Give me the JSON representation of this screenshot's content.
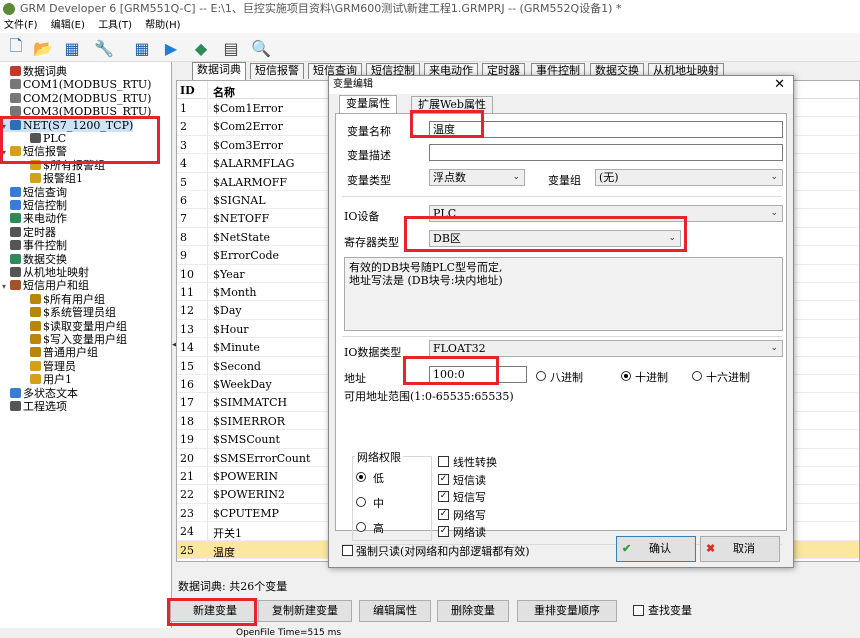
{
  "window": {
    "title": "GRM Developer 6 [GRM551Q-C]  -- E:\\1、巨控实施项目资料\\GRM600测试\\新建工程1.GRMPRJ -- (GRM552Q设备1) *"
  },
  "menu": [
    "文件(F)",
    "编辑(E)",
    "工具(T)",
    "帮助(H)"
  ],
  "toolbar": [
    {
      "icon": "new-file-icon",
      "glyph": "🗋"
    },
    {
      "icon": "open-folder-icon",
      "glyph": "📂"
    },
    {
      "icon": "save-icon",
      "glyph": "▦"
    },
    {
      "icon": "wrench-icon",
      "glyph": "🔧"
    },
    {
      "icon": "grid-icon",
      "glyph": "▦"
    },
    {
      "icon": "download-icon",
      "glyph": "▶"
    },
    {
      "icon": "upload-icon",
      "glyph": "◆"
    },
    {
      "icon": "monitor-icon",
      "glyph": "▤"
    },
    {
      "icon": "search-icon",
      "glyph": "🔍"
    }
  ],
  "tree": [
    {
      "label": "数据词典",
      "icon": "dictionary-icon",
      "color": "#c0392b",
      "depth": 0
    },
    {
      "label": "COM1(MODBUS_RTU)",
      "icon": "serial-port-icon",
      "color": "#777777",
      "depth": 0
    },
    {
      "label": "COM2(MODBUS_RTU)",
      "icon": "serial-port-icon",
      "color": "#777777",
      "depth": 0
    },
    {
      "label": "COM3(MODBUS_RTU)",
      "icon": "serial-port-icon",
      "color": "#777777",
      "depth": 0
    },
    {
      "label": "NET(S7_1200_TCP)",
      "icon": "network-icon",
      "color": "#2c6fb8",
      "depth": 0,
      "expander": "▾",
      "selected": true
    },
    {
      "label": "PLC",
      "icon": "plc-icon",
      "color": "#555555",
      "depth": 1
    },
    {
      "label": "短信报警",
      "icon": "bell-icon",
      "color": "#d4a017",
      "depth": 0,
      "expander": "▾"
    },
    {
      "label": "$所有报警组",
      "icon": "alarm-group-icon",
      "color": "#d4a017",
      "depth": 1
    },
    {
      "label": "报警组1",
      "icon": "alarm-group-icon",
      "color": "#d4a017",
      "depth": 1
    },
    {
      "label": "短信查询",
      "icon": "sms-query-icon",
      "color": "#3a7bd5",
      "depth": 0
    },
    {
      "label": "短信控制",
      "icon": "sms-control-icon",
      "color": "#3a7bd5",
      "depth": 0
    },
    {
      "label": "来电动作",
      "icon": "phone-icon",
      "color": "#2e8b57",
      "depth": 0
    },
    {
      "label": "定时器",
      "icon": "clock-icon",
      "color": "#555555",
      "depth": 0
    },
    {
      "label": "事件控制",
      "icon": "event-icon",
      "color": "#555555",
      "depth": 0
    },
    {
      "label": "数据交换",
      "icon": "exchange-icon",
      "color": "#2e8b57",
      "depth": 0
    },
    {
      "label": "从机地址映射",
      "icon": "slave-map-icon",
      "color": "#555555",
      "depth": 0
    },
    {
      "label": "短信用户和组",
      "icon": "users-icon",
      "color": "#a0522d",
      "depth": 0,
      "expander": "▾"
    },
    {
      "label": "$所有用户组",
      "icon": "user-group-icon",
      "color": "#b8860b",
      "depth": 1
    },
    {
      "label": "$系统管理员组",
      "icon": "user-group-icon",
      "color": "#b8860b",
      "depth": 1
    },
    {
      "label": "$读取变量用户组",
      "icon": "user-group-icon",
      "color": "#b8860b",
      "depth": 1
    },
    {
      "label": "$写入变量用户组",
      "icon": "user-group-icon",
      "color": "#b8860b",
      "depth": 1
    },
    {
      "label": "普通用户组",
      "icon": "user-group-icon",
      "color": "#b8860b",
      "depth": 1
    },
    {
      "label": "管理员",
      "icon": "user-icon",
      "color": "#d4a017",
      "depth": 1
    },
    {
      "label": "用户1",
      "icon": "user-icon",
      "color": "#d4a017",
      "depth": 1
    },
    {
      "label": "多状态文本",
      "icon": "multistate-text-icon",
      "color": "#3a7bd5",
      "depth": 0
    },
    {
      "label": "工程选项",
      "icon": "gear-icon",
      "color": "#555555",
      "depth": 0
    }
  ],
  "tabs": [
    "数据词典",
    "短信报警",
    "短信查询",
    "短信控制",
    "来电动作",
    "定时器",
    "事件控制",
    "数据交换",
    "从机地址映射"
  ],
  "grid": {
    "headers": {
      "id": "ID",
      "name": "名称"
    },
    "rows": [
      {
        "id": "1",
        "name": "$Com1Error"
      },
      {
        "id": "2",
        "name": "$Com2Error"
      },
      {
        "id": "3",
        "name": "$Com3Error"
      },
      {
        "id": "4",
        "name": "$ALARMFLAG"
      },
      {
        "id": "5",
        "name": "$ALARMOFF"
      },
      {
        "id": "6",
        "name": "$SIGNAL"
      },
      {
        "id": "7",
        "name": "$NETOFF"
      },
      {
        "id": "8",
        "name": "$NetState"
      },
      {
        "id": "9",
        "name": "$ErrorCode"
      },
      {
        "id": "10",
        "name": "$Year"
      },
      {
        "id": "11",
        "name": "$Month"
      },
      {
        "id": "12",
        "name": "$Day"
      },
      {
        "id": "13",
        "name": "$Hour"
      },
      {
        "id": "14",
        "name": "$Minute"
      },
      {
        "id": "15",
        "name": "$Second"
      },
      {
        "id": "16",
        "name": "$WeekDay"
      },
      {
        "id": "17",
        "name": "$SIMMATCH"
      },
      {
        "id": "18",
        "name": "$SIMERROR"
      },
      {
        "id": "19",
        "name": "$SMSCount"
      },
      {
        "id": "20",
        "name": "$SMSErrorCount"
      },
      {
        "id": "21",
        "name": "$POWERIN"
      },
      {
        "id": "22",
        "name": "$POWERIN2"
      },
      {
        "id": "23",
        "name": "$CPUTEMP"
      },
      {
        "id": "24",
        "name": "开关1"
      },
      {
        "id": "25",
        "name": "温度",
        "selected": true
      }
    ]
  },
  "dict_status": "数据词典: 共26个变量",
  "bottom_buttons": {
    "new_var": "新建变量",
    "copy_new": "复制新建变量",
    "edit_attr": "编辑属性",
    "delete_var": "删除变量",
    "reorder": "重排变量顺序",
    "find_var": "查找变量"
  },
  "status_bar": "OpenFile Time=515 ms",
  "dialog": {
    "title": "变量编辑",
    "close": "✕",
    "tabs": [
      "变量属性",
      "扩展Web属性"
    ],
    "var_name_label": "变量名称",
    "var_name_value": "温度",
    "var_desc_label": "变量描述",
    "var_desc_value": "",
    "var_type_label": "变量类型",
    "var_type_value": "浮点数",
    "var_group_label": "变量组",
    "var_group_value": "(无)",
    "io_device_label": "IO设备",
    "io_device_value": "PLC",
    "reg_type_label": "寄存器类型",
    "reg_type_value": "DB区",
    "note_line1": "有效的DB块号随PLC型号而定,",
    "note_line2": "地址写法是 (DB块号:块内地址)",
    "io_data_type_label": "IO数据类型",
    "io_data_type_value": "FLOAT32",
    "address_label": "地址",
    "address_value": "100:0",
    "radix_options": [
      "八进制",
      "十进制",
      "十六进制"
    ],
    "radix_selected": "十进制",
    "address_range": "可用地址范围(1:0-65535:65535)",
    "net_perm_title": "网络权限",
    "net_perm_options": [
      "低",
      "中",
      "高"
    ],
    "net_perm_selected": "低",
    "checks": [
      {
        "label": "线性转换",
        "checked": false
      },
      {
        "label": "短信读",
        "checked": true
      },
      {
        "label": "短信写",
        "checked": true
      },
      {
        "label": "网络写",
        "checked": true
      },
      {
        "label": "网络读",
        "checked": true
      }
    ],
    "force_readonly_label": "强制只读(对网络和内部逻辑都有效)",
    "force_readonly_checked": false,
    "ok_label": "确认",
    "cancel_label": "取消"
  },
  "colors": {
    "highlight_box": "#e8232a",
    "selected_row": "#fbe79e",
    "ok_icon": "#2e9e3e",
    "cancel_icon": "#d9302a"
  }
}
